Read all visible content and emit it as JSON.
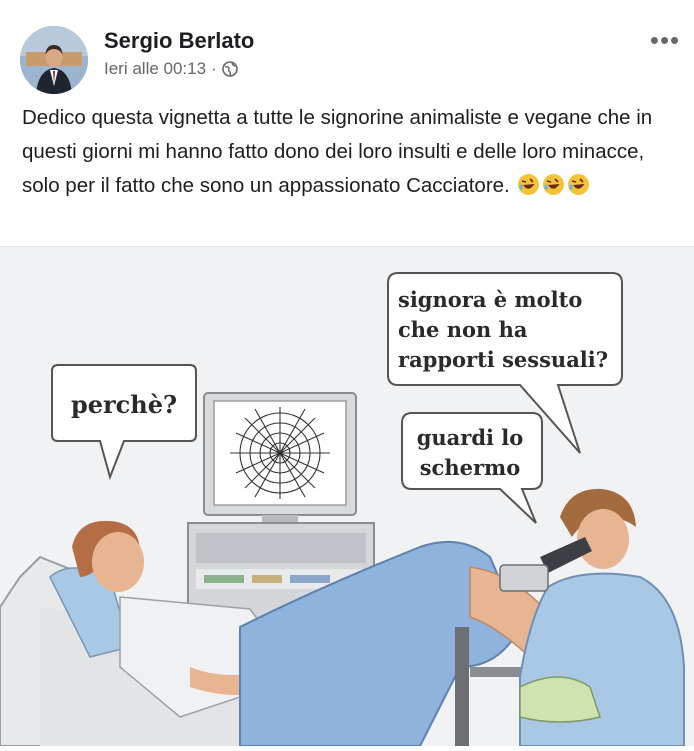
{
  "post": {
    "author": "Sergio Berlato",
    "time": "Ieri alle 00:13",
    "separator": "·",
    "audience_icon": "globe-icon",
    "more_label": "•••",
    "text": "Dedico questa vignetta a tutte le signorine animaliste e vegane che in questi giorni mi hanno fatto dono dei loro insulti e delle loro minacce, solo per il fatto che sono un appassionato Cacciatore.",
    "emojis": [
      "rofl-emoji",
      "rofl-emoji",
      "rofl-emoji"
    ]
  },
  "cartoon": {
    "bubble_left": "perchè?",
    "bubble_doctor_line1": "signora è molto",
    "bubble_doctor_line2": "che non ha",
    "bubble_doctor_line3": "rapporti sessuali?",
    "bubble_mid_line1": "guardi lo",
    "bubble_mid_line2": "schermo"
  },
  "colors": {
    "text": "#1c1e21",
    "meta": "#65676b",
    "sheet": "#8fb3dc",
    "scrubs": "#a9c8e6",
    "skin": "#e7b592"
  }
}
